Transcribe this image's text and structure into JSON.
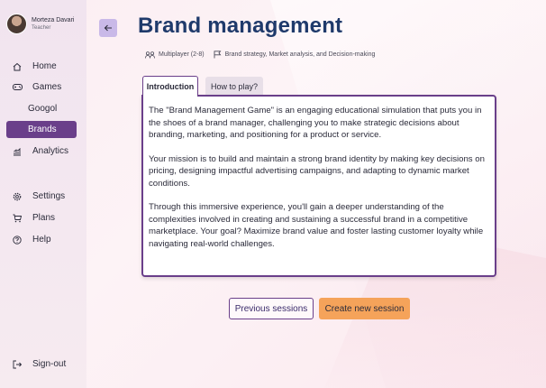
{
  "user": {
    "name": "Morteza Davari",
    "role": "Teacher"
  },
  "nav": {
    "home": "Home",
    "games": "Games",
    "googol": "Googol",
    "brands": "Brands",
    "analytics": "Analytics",
    "settings": "Settings",
    "plans": "Plans",
    "help": "Help",
    "signout": "Sign-out"
  },
  "page": {
    "title": "Brand management",
    "players": "Multiplayer (2-8)",
    "skills": "Brand strategy, Market analysis, and Decision-making"
  },
  "tabs": {
    "intro": "Introduction",
    "howto": "How to play?"
  },
  "content": {
    "p1": "The \"Brand Management Game\" is an engaging educational simulation that puts you in the shoes of a brand manager, challenging you to make strategic decisions about branding, marketing, and positioning for a product or service.",
    "p2": "Your mission is to build and maintain a strong brand identity by making key decisions on pricing, designing impactful advertising campaigns, and adapting to dynamic market conditions.",
    "p3": "Through this immersive experience, you'll gain a deeper understanding of the complexities involved in creating and sustaining a successful brand in a competitive marketplace. Your goal? Maximize brand value and foster lasting customer loyalty while navigating real-world challenges."
  },
  "actions": {
    "previous": "Previous sessions",
    "create": "Create new session"
  },
  "colors": {
    "accent": "#6a3f8a",
    "title": "#1f3a6b",
    "cta": "#f5a35a"
  }
}
